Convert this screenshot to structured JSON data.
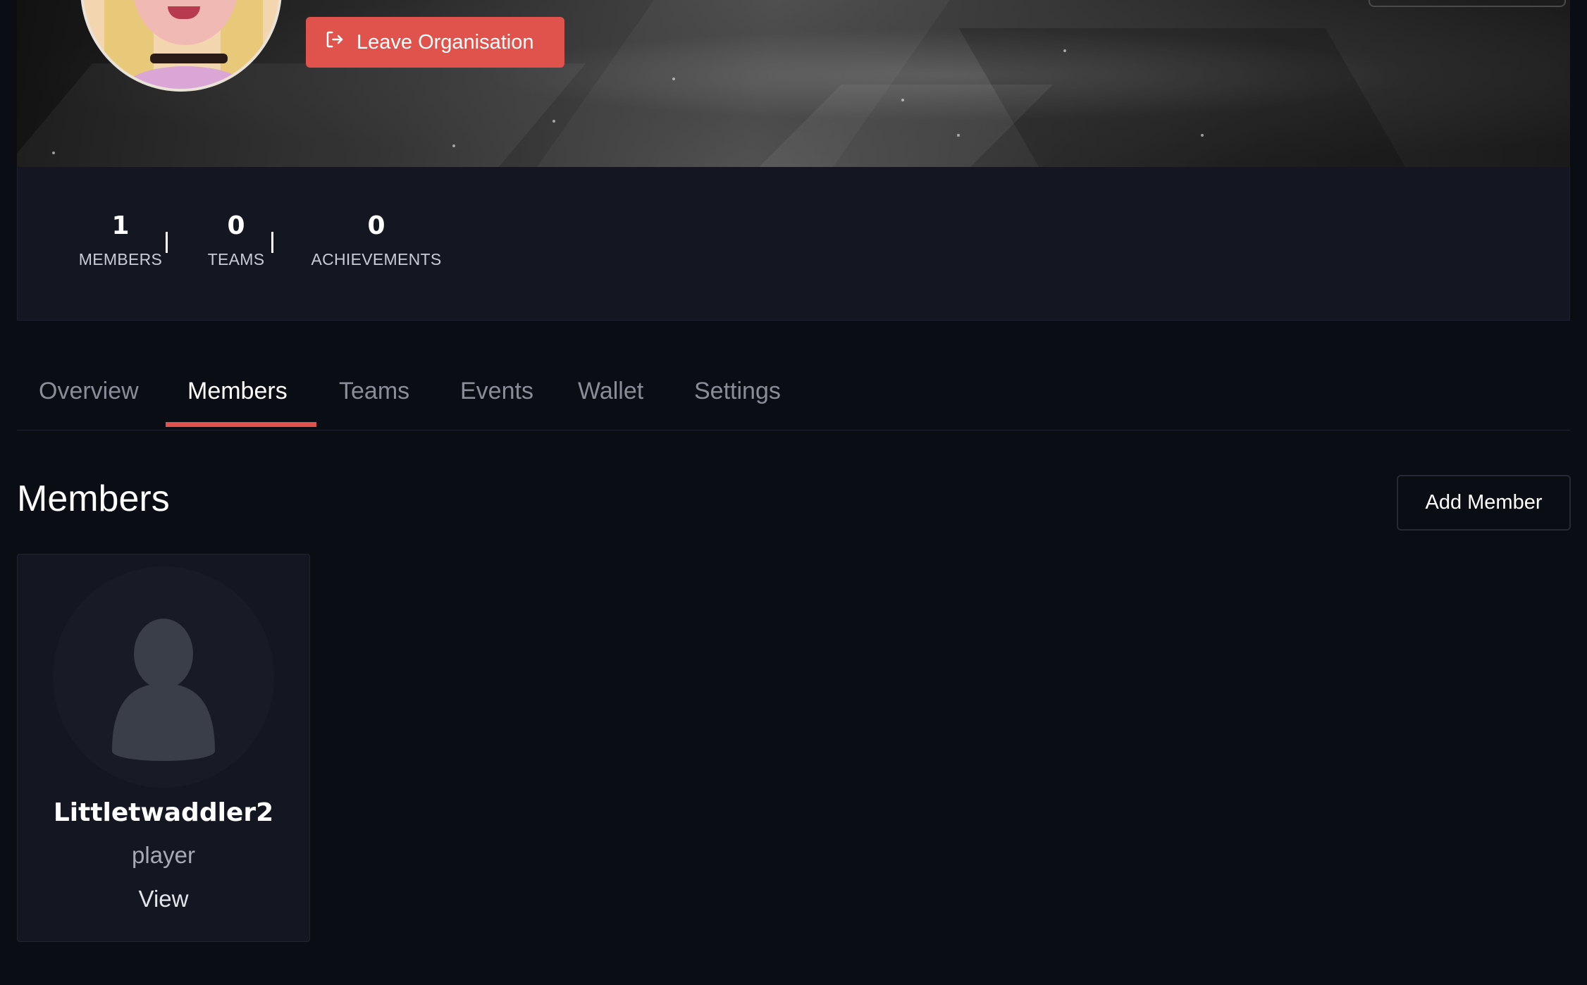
{
  "organisation": {
    "leave_button_label": "Leave Organisation"
  },
  "stats": {
    "members": {
      "value": "1",
      "label": "MEMBERS"
    },
    "teams": {
      "value": "0",
      "label": "TEAMS"
    },
    "achievements": {
      "value": "0",
      "label": "ACHIEVEMENTS"
    }
  },
  "tabs": [
    {
      "label": "Overview",
      "active": false
    },
    {
      "label": "Members",
      "active": true
    },
    {
      "label": "Teams",
      "active": false
    },
    {
      "label": "Events",
      "active": false
    },
    {
      "label": "Wallet",
      "active": false
    },
    {
      "label": "Settings",
      "active": false
    }
  ],
  "members_section": {
    "title": "Members",
    "add_button_label": "Add Member",
    "members": [
      {
        "name": "Littletwaddler2",
        "role": "player",
        "view_label": "View"
      }
    ]
  },
  "icons": {
    "leave": "logout-icon",
    "member_avatar": "user-placeholder-icon"
  },
  "colors": {
    "accent": "#e0524c",
    "background": "#0b0d15",
    "panel": "#141722"
  }
}
